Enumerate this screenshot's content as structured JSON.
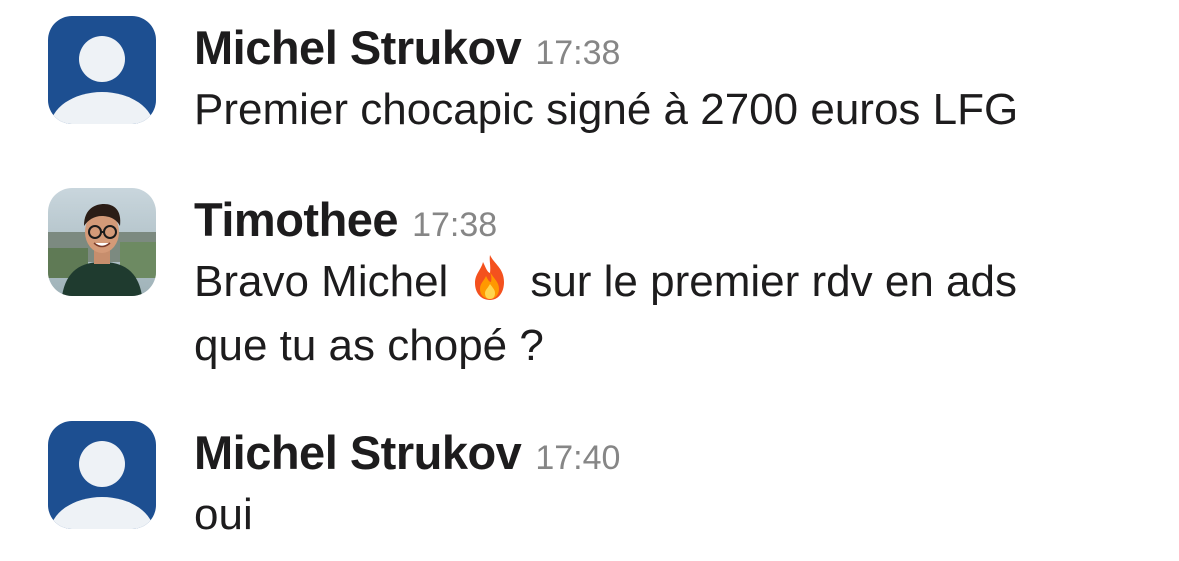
{
  "messages": [
    {
      "author": "Michel Strukov",
      "time": "17:38",
      "avatar": "default-user-avatar",
      "text": "Premier chocapic signé à 2700 euros LFG"
    },
    {
      "author": "Timothee",
      "time": "17:38",
      "avatar": "user-photo-avatar",
      "text_line1_before": "Bravo Michel",
      "emoji": "fire-emoji",
      "text_line1_after": "sur le premier rdv en ads",
      "text_line2": "que tu as chopé ?"
    },
    {
      "author": "Michel Strukov",
      "time": "17:40",
      "avatar": "default-user-avatar",
      "text": "oui"
    }
  ],
  "colors": {
    "default_avatar_bg": "#1d4f91",
    "default_avatar_fg": "#eef2f6",
    "timestamp": "#868686",
    "text": "#1d1c1d"
  }
}
